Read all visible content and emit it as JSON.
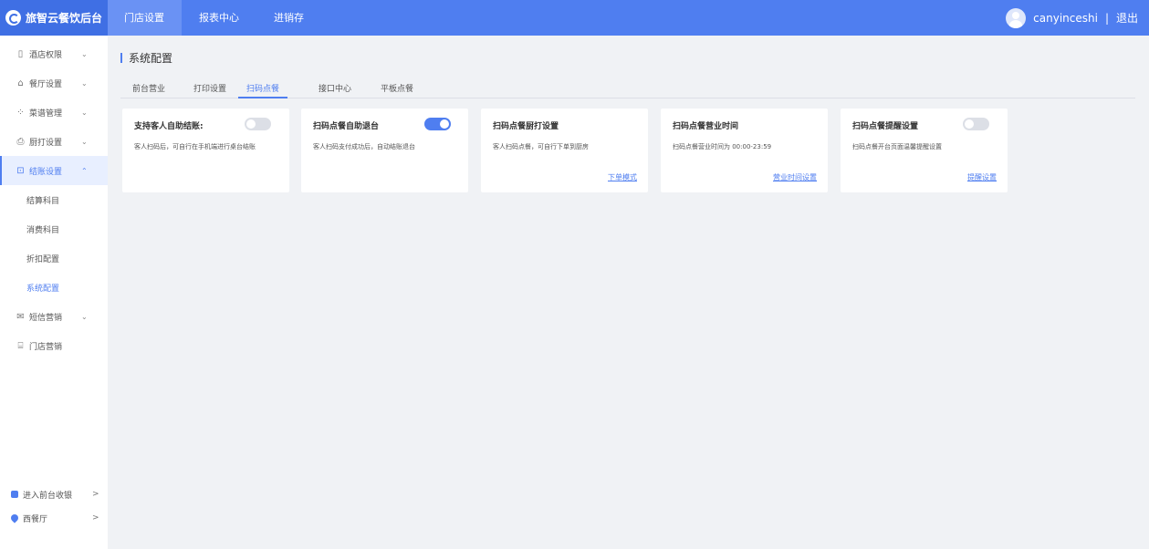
{
  "brand": {
    "name": "旅智云餐饮后台"
  },
  "topnav": [
    {
      "label": "门店设置"
    },
    {
      "label": "报表中心"
    },
    {
      "label": "进销存"
    }
  ],
  "user": {
    "name": "canyinceshi",
    "separator": "|",
    "logout": "退出"
  },
  "sidebar": {
    "items": [
      {
        "label": "酒店权限",
        "icon": "building-icon",
        "chevron": "⌄"
      },
      {
        "label": "餐厅设置",
        "icon": "home-icon",
        "chevron": "⌄"
      },
      {
        "label": "菜谱管理",
        "icon": "grid-icon",
        "chevron": "⌄"
      },
      {
        "label": "厨打设置",
        "icon": "printer-icon",
        "chevron": "⌄"
      },
      {
        "label": "结账设置",
        "icon": "checkout-icon",
        "chevron": "⌃"
      }
    ],
    "subitems": [
      {
        "label": "结算科目"
      },
      {
        "label": "消费科目"
      },
      {
        "label": "折扣配置"
      },
      {
        "label": "系统配置"
      }
    ],
    "items_after": [
      {
        "label": "短信营销",
        "icon": "mail-icon",
        "chevron": "⌄"
      },
      {
        "label": "门店营销",
        "icon": "store-icon"
      }
    ],
    "bottom": [
      {
        "label": "进入前台收银",
        "chevron": ">"
      },
      {
        "label": "西餐厅",
        "chevron": ">"
      }
    ]
  },
  "page": {
    "title": "系统配置"
  },
  "tabs": [
    {
      "label": "前台营业"
    },
    {
      "label": "打印设置"
    },
    {
      "label": "扫码点餐",
      "active": true
    },
    {
      "label": "接口中心"
    },
    {
      "label": "平板点餐"
    }
  ],
  "cards": [
    {
      "title": "支持客人自助结账:",
      "desc": "客人扫码后，可自行在手机端进行桌台结账",
      "toggle": false
    },
    {
      "title": "扫码点餐自助退台",
      "desc": "客人扫码支付成功后，自动结账退台",
      "toggle": true
    },
    {
      "title": "扫码点餐厨打设置",
      "desc": "客人扫码点餐，可自行下单到厨房",
      "link": "下单模式"
    },
    {
      "title": "扫码点餐营业时间",
      "desc": "扫码点餐营业时间为 00:00-23:59",
      "link": "营业时间设置"
    },
    {
      "title": "扫码点餐提醒设置",
      "desc": "扫码点餐开台页面温馨提醒设置",
      "link": "提醒设置",
      "toggle": false
    }
  ],
  "colors": {
    "primary": "#4f7ef0",
    "topbar": "#4f7ef0",
    "brand_bg": "#3f6fe4",
    "toggle_off": "#dcdfe6"
  }
}
